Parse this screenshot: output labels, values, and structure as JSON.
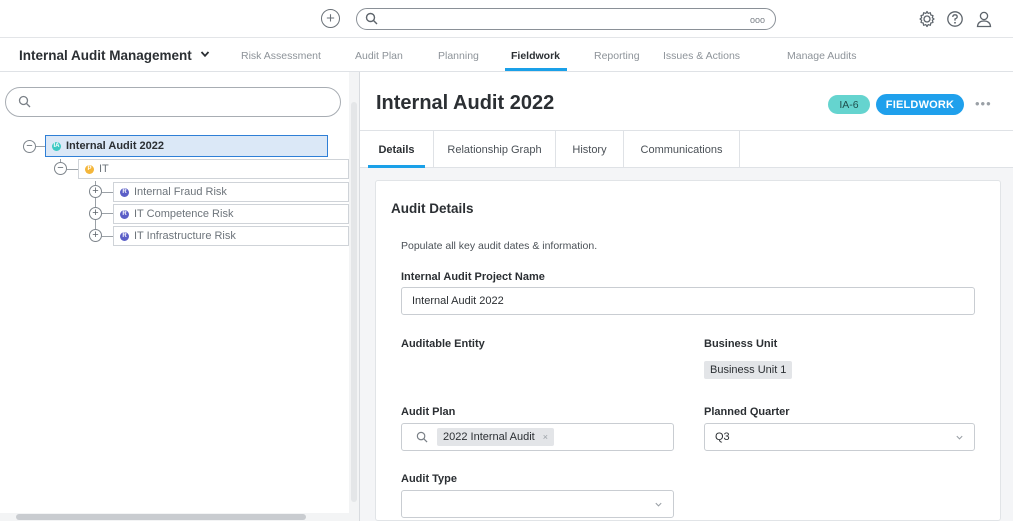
{
  "topbar": {
    "add_symbol": "+",
    "search_placeholder": "",
    "search_options_symbol": "ooo",
    "icons": [
      "add-icon",
      "search-icon",
      "gear-icon",
      "help-icon",
      "user-icon"
    ]
  },
  "app": {
    "title": "Internal Audit Management"
  },
  "nav": {
    "tabs": [
      {
        "label": "Risk Assessment",
        "active": false
      },
      {
        "label": "Audit Plan",
        "active": false
      },
      {
        "label": "Planning",
        "active": false
      },
      {
        "label": "Fieldwork",
        "active": true
      },
      {
        "label": "Reporting",
        "active": false
      },
      {
        "label": "Issues & Actions",
        "active": false
      },
      {
        "label": "Manage Audits",
        "active": false
      }
    ]
  },
  "tree": {
    "search_placeholder": "",
    "nodes": [
      {
        "badge": "IA",
        "label": "Internal Audit 2022",
        "color": "#3cc9c3",
        "selected": true
      },
      {
        "badge": "P",
        "label": "IT",
        "color": "#f4b63a",
        "selected": false
      },
      {
        "badge": "R",
        "label": "Internal Fraud Risk",
        "color": "#5b5fc7",
        "selected": false
      },
      {
        "badge": "R",
        "label": "IT Competence Risk",
        "color": "#5b5fc7",
        "selected": false
      },
      {
        "badge": "R",
        "label": "IT Infrastructure Risk",
        "color": "#5b5fc7",
        "selected": false
      }
    ],
    "collapse_symbol": "−",
    "expand_symbol": "+"
  },
  "record": {
    "title": "Internal Audit 2022",
    "id": "IA-6",
    "status": "FIELDWORK",
    "more": "•••"
  },
  "tabs": [
    {
      "label": "Details",
      "active": true
    },
    {
      "label": "Relationship Graph",
      "active": false
    },
    {
      "label": "History",
      "active": false
    },
    {
      "label": "Communications",
      "active": false
    }
  ],
  "form": {
    "section_title": "Audit Details",
    "helper": "Populate all key audit dates & information.",
    "project_name_label": "Internal Audit Project Name",
    "project_name_value": "Internal Audit 2022",
    "auditable_entity_label": "Auditable Entity",
    "business_unit_label": "Business Unit",
    "business_unit_value": "Business Unit 1",
    "audit_plan_label": "Audit Plan",
    "audit_plan_value": "2022 Internal Audit",
    "audit_plan_remove": "×",
    "planned_quarter_label": "Planned Quarter",
    "planned_quarter_value": "Q3",
    "audit_type_label": "Audit Type",
    "audit_type_value": ""
  },
  "colors": {
    "accent": "#1aa0e8",
    "id_badge": "#65d4cf",
    "status_badge": "#1fa0ec",
    "selected_node_bg": "#dbe8f7"
  }
}
